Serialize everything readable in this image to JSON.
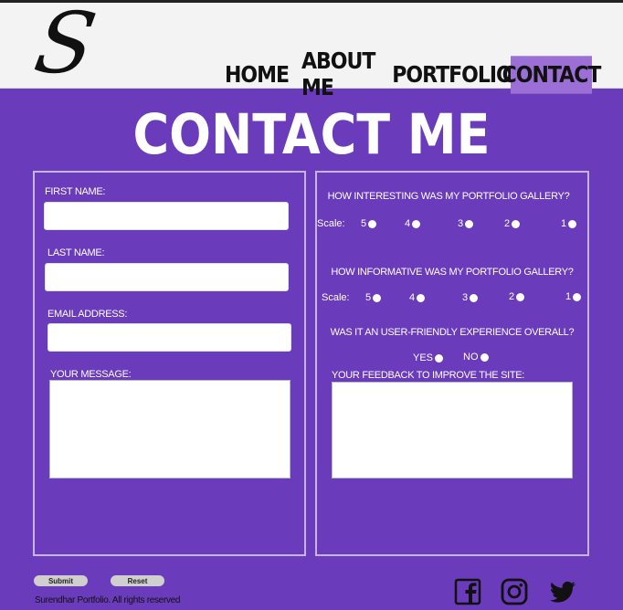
{
  "header": {
    "logo_letter": "S",
    "nav": [
      {
        "label": "HOME"
      },
      {
        "label": "ABOUT ME"
      },
      {
        "label": "PORTFOLIO"
      },
      {
        "label": "CONTACT"
      }
    ],
    "active_nav": "CONTACT",
    "accent": "#9b6fd6"
  },
  "page_title": "CONTACT ME",
  "form": {
    "first_name_label": "FIRST NAME:",
    "first_name_value": "",
    "last_name_label": "LAST NAME:",
    "last_name_value": "",
    "email_label": "EMAIL ADDRESS:",
    "email_value": "",
    "message_label": "YOUR MESSAGE:",
    "message_value": ""
  },
  "survey": {
    "q1": "HOW INTERESTING WAS MY PORTFOLIO GALLERY?",
    "q2": "HOW INFORMATIVE WAS MY PORTFOLIO GALLERY?",
    "q3": "WAS IT AN USER-FRIENDLY EXPERIENCE OVERALL?",
    "scale_label": "Scale:",
    "scale": [
      "5",
      "4",
      "3",
      "2",
      "1"
    ],
    "yes": "YES",
    "no": "NO",
    "feedback_label": "YOUR FEEDBACK TO IMPROVE THE SITE:",
    "feedback_value": ""
  },
  "buttons": {
    "submit": "Submit",
    "reset": "Reset"
  },
  "footer": {
    "copyright": "Surendhar Portfolio. All rights reserved"
  },
  "social": {
    "icons": [
      "facebook-icon",
      "instagram-icon",
      "twitter-icon"
    ]
  },
  "colors": {
    "background": "#6a3bba",
    "panel_border": "#c9b3ee"
  }
}
